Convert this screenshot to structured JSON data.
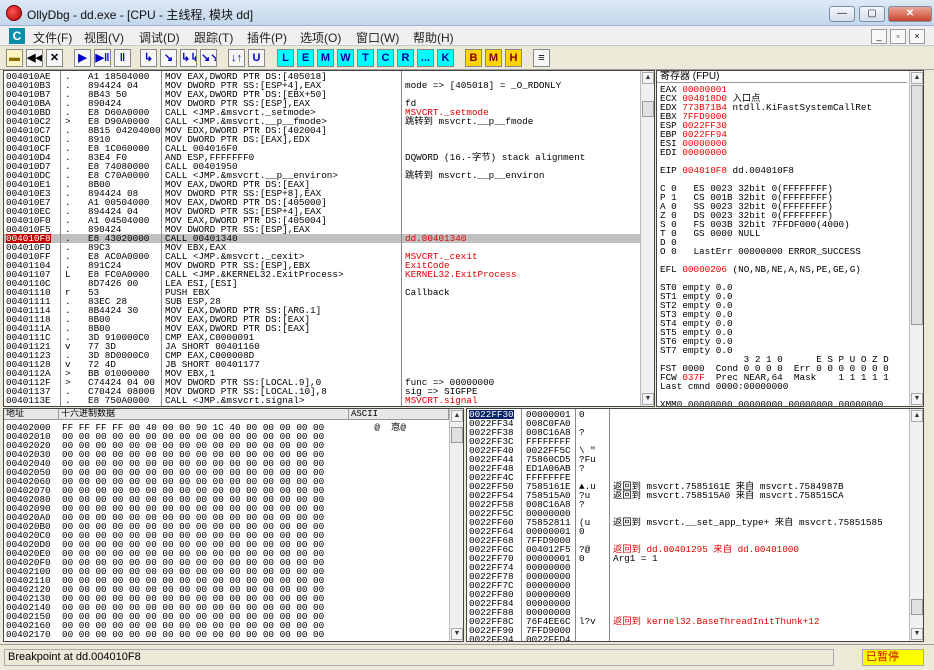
{
  "window": {
    "title": "OllyDbg - dd.exe - [CPU - 主线程, 模块 dd]",
    "min": "—",
    "max": "▢",
    "close": "✕"
  },
  "menu": {
    "cpu_icon": "C",
    "items": [
      "文件(F)",
      "视图(V)",
      "调试(D)",
      "跟踪(T)",
      "插件(P)",
      "选项(O)",
      "窗口(W)",
      "帮助(H)"
    ],
    "mdi": [
      "_",
      "▫",
      "×"
    ]
  },
  "toolbar": {
    "nav": [
      "▶▶",
      "◀◀",
      "✕",
      "▶",
      "▶‖",
      "‖",
      "↳",
      "↘",
      "↳↳",
      "↘↘",
      "↓↑",
      "U"
    ],
    "letters": [
      "L",
      "E",
      "M",
      "W",
      "T",
      "C",
      "R",
      "...",
      "K"
    ],
    "extra": [
      "B",
      "M",
      "H",
      "≡"
    ]
  },
  "disasm": {
    "rows": [
      {
        "addr": "004010AE",
        "mark": ".",
        "hex": "A1 18504000",
        "code": "MOV EAX,DWORD PTR DS:[405018]",
        "comment": ""
      },
      {
        "addr": "004010B3",
        "mark": ".",
        "hex": "894424 04",
        "code": "MOV DWORD PTR SS:[ESP+4],EAX",
        "comment": "mode => [405018] = _O_RDONLY"
      },
      {
        "addr": "004010B7",
        "mark": ".",
        "hex": "8B43 50",
        "code": "MOV EAX,DWORD PTR DS:[EBX+50]",
        "comment": ""
      },
      {
        "addr": "004010BA",
        "mark": ".",
        "hex": "890424",
        "code": "MOV DWORD PTR SS:[ESP],EAX",
        "comment": "fd"
      },
      {
        "addr": "004010BD",
        "mark": ".",
        "hex": "E8 D60A0000",
        "code": "CALL <JMP.&msvcrt._setmode>",
        "comment": "MSVCRT._setmode"
      },
      {
        "addr": "004010C2",
        "mark": ">",
        "hex": "E8 D90A0000",
        "code": "CALL <JMP.&msvcrt.__p__fmode>",
        "comment": "跳转到 msvcrt.__p__fmode"
      },
      {
        "addr": "004010C7",
        "mark": ".",
        "hex": "8B15 04204000",
        "code": "MOV EDX,DWORD PTR DS:[402004]",
        "comment": ""
      },
      {
        "addr": "004010CD",
        "mark": ".",
        "hex": "8910",
        "code": "MOV DWORD PTR DS:[EAX],EDX",
        "comment": ""
      },
      {
        "addr": "004010CF",
        "mark": ".",
        "hex": "E8 1C060000",
        "code": "CALL 004016F0",
        "comment": ""
      },
      {
        "addr": "004010D4",
        "mark": ".",
        "hex": "83E4 F0",
        "code": "AND ESP,FFFFFFF0",
        "comment": "DQWORD (16.-字节) stack alignment"
      },
      {
        "addr": "004010D7",
        "mark": ".",
        "hex": "E8 74080000",
        "code": "CALL 00401950",
        "comment": ""
      },
      {
        "addr": "004010DC",
        "mark": ".",
        "hex": "E8 C70A0000",
        "code": "CALL <JMP.&msvcrt.__p__environ>",
        "comment": "跳转到 msvcrt.__p__environ"
      },
      {
        "addr": "004010E1",
        "mark": ".",
        "hex": "8B00",
        "code": "MOV EAX,DWORD PTR DS:[EAX]",
        "comment": ""
      },
      {
        "addr": "004010E3",
        "mark": ".",
        "hex": "894424 08",
        "code": "MOV DWORD PTR SS:[ESP+8],EAX",
        "comment": ""
      },
      {
        "addr": "004010E7",
        "mark": ".",
        "hex": "A1 00504000",
        "code": "MOV EAX,DWORD PTR DS:[405000]",
        "comment": ""
      },
      {
        "addr": "004010EC",
        "mark": ".",
        "hex": "894424 04",
        "code": "MOV DWORD PTR SS:[ESP+4],EAX",
        "comment": ""
      },
      {
        "addr": "004010F0",
        "mark": ".",
        "hex": "A1 04504000",
        "code": "MOV EAX,DWORD PTR DS:[405004]",
        "comment": ""
      },
      {
        "addr": "004010F5",
        "mark": ".",
        "hex": "890424",
        "code": "MOV DWORD PTR SS:[ESP],EAX",
        "comment": ""
      },
      {
        "addr": "004010F8",
        "mark": ".",
        "hex": "E8 43020000",
        "code": "CALL 00401340",
        "comment": "dd.00401340",
        "selected": true
      },
      {
        "addr": "004010FD",
        "mark": ".",
        "hex": "89C3",
        "code": "MOV EBX,EAX",
        "comment": ""
      },
      {
        "addr": "004010FF",
        "mark": ".",
        "hex": "E8 AC0A0000",
        "code": "CALL <JMP.&msvcrt._cexit>",
        "comment": "MSVCRT._cexit"
      },
      {
        "addr": "00401104",
        "mark": ".",
        "hex": "891C24",
        "code": "MOV DWORD PTR SS:[ESP],EBX",
        "comment": "ExitCode"
      },
      {
        "addr": "00401107",
        "mark": "L",
        "hex": "E8 FC0A0000",
        "code": "CALL <JMP.&KERNEL32.ExitProcess>",
        "comment": "KERNEL32.ExitProcess"
      },
      {
        "addr": "0040110C",
        "mark": "",
        "hex": "8D7426 00",
        "code": "LEA ESI,[ESI]",
        "comment": ""
      },
      {
        "addr": "00401110",
        "mark": "r",
        "hex": "53",
        "code": "PUSH EBX",
        "comment": "Callback"
      },
      {
        "addr": "00401111",
        "mark": ".",
        "hex": "83EC 28",
        "code": "SUB ESP,28",
        "comment": ""
      },
      {
        "addr": "00401114",
        "mark": ".",
        "hex": "8B4424 30",
        "code": "MOV EAX,DWORD PTR SS:[ARG.1]",
        "comment": ""
      },
      {
        "addr": "00401118",
        "mark": ".",
        "hex": "8B00",
        "code": "MOV EAX,DWORD PTR DS:[EAX]",
        "comment": ""
      },
      {
        "addr": "0040111A",
        "mark": ".",
        "hex": "8B00",
        "code": "MOV EAX,DWORD PTR DS:[EAX]",
        "comment": ""
      },
      {
        "addr": "0040111C",
        "mark": ".",
        "hex": "3D 910000C0",
        "code": "CMP EAX,C0000091",
        "comment": ""
      },
      {
        "addr": "00401121",
        "mark": "v",
        "hex": "77 3D",
        "code": "JA SHORT 00401160",
        "comment": ""
      },
      {
        "addr": "00401123",
        "mark": ".",
        "hex": "3D 8D0000C0",
        "code": "CMP EAX,C000008D",
        "comment": ""
      },
      {
        "addr": "00401128",
        "mark": "v",
        "hex": "72 4D",
        "code": "JB SHORT 00401177",
        "comment": ""
      },
      {
        "addr": "0040112A",
        "mark": ">",
        "hex": "BB 01000000",
        "code": "MOV EBX,1",
        "comment": ""
      },
      {
        "addr": "0040112F",
        "mark": ">",
        "hex": "C74424 04 00",
        "code": "MOV DWORD PTR SS:[LOCAL.9],0",
        "comment": "func => 00000000"
      },
      {
        "addr": "00401137",
        "mark": ".",
        "hex": "C70424 08000",
        "code": "MOV DWORD PTR SS:[LOCAL.10],8",
        "comment": "sig => SIGFPE"
      },
      {
        "addr": "0040113E",
        "mark": ".",
        "hex": "E8 750A0000",
        "code": "CALL <JMP.&msvcrt.signal>",
        "comment": "MSVCRT.signal"
      }
    ]
  },
  "registers": {
    "header": "寄存器 (FPU)",
    "lines": [
      {
        "t": "EAX ",
        "v": "00000001",
        "r": ""
      },
      {
        "t": "ECX ",
        "v": "004018D0",
        "r": " 入口点"
      },
      {
        "t": "EDX ",
        "v": "773B71B4",
        "r": " ntdll.KiFastSystemCallRet"
      },
      {
        "t": "EBX ",
        "v": "7FFD9000",
        "r": ""
      },
      {
        "t": "ESP ",
        "v": "0022FF30",
        "r": ""
      },
      {
        "t": "EBP ",
        "v": "0022FF94",
        "r": ""
      },
      {
        "t": "ESI ",
        "v": "00000000",
        "r": ""
      },
      {
        "t": "EDI ",
        "v": "00000000",
        "r": ""
      },
      {
        "t": "",
        "v": "",
        "r": ""
      },
      {
        "t": "EIP ",
        "v": "004010F8",
        "r": " dd.004010F8"
      },
      {
        "t": "",
        "v": "",
        "r": ""
      },
      {
        "t": "C 0   ES 0023 32bit 0(FFFFFFFF)",
        "v": "",
        "r": ""
      },
      {
        "t": "P 1   CS 001B 32bit 0(FFFFFFFF)",
        "v": "",
        "r": ""
      },
      {
        "t": "A 0   SS 0023 32bit 0(FFFFFFFF)",
        "v": "",
        "r": ""
      },
      {
        "t": "Z 0   DS 0023 32bit 0(FFFFFFFF)",
        "v": "",
        "r": ""
      },
      {
        "t": "S 0   FS 003B 32bit 7FFDF000(4000)",
        "v": "",
        "r": ""
      },
      {
        "t": "T 0   GS 0000 NULL",
        "v": "",
        "r": ""
      },
      {
        "t": "D 0",
        "v": "",
        "r": ""
      },
      {
        "t": "O 0   LastErr 00000000 ERROR_SUCCESS",
        "v": "",
        "r": ""
      },
      {
        "t": "",
        "v": "",
        "r": ""
      },
      {
        "t": "EFL ",
        "v": "00000206",
        "r": " (NO,NB,NE,A,NS,PE,GE,G)"
      },
      {
        "t": "",
        "v": "",
        "r": ""
      },
      {
        "t": "ST0 empty 0.0",
        "v": "",
        "r": ""
      },
      {
        "t": "ST1 empty 0.0",
        "v": "",
        "r": ""
      },
      {
        "t": "ST2 empty 0.0",
        "v": "",
        "r": ""
      },
      {
        "t": "ST3 empty 0.0",
        "v": "",
        "r": ""
      },
      {
        "t": "ST4 empty 0.0",
        "v": "",
        "r": ""
      },
      {
        "t": "ST5 empty 0.0",
        "v": "",
        "r": ""
      },
      {
        "t": "ST6 empty 0.0",
        "v": "",
        "r": ""
      },
      {
        "t": "ST7 empty 0.0",
        "v": "",
        "r": ""
      },
      {
        "t": "               3 2 1 0      E S P U O Z D",
        "v": "",
        "r": ""
      },
      {
        "t": "FST 0000  Cond 0 0 0 0  Err 0 0 0 0 0 0 0",
        "v": "",
        "r": ""
      },
      {
        "t": "FCW ",
        "v": "037F",
        "r": "  Prec NEAR,64  Mask    1 1 1 1 1"
      },
      {
        "t": "Last cmnd 0000:00000000",
        "v": "",
        "r": ""
      },
      {
        "t": "",
        "v": "",
        "r": ""
      },
      {
        "t": "XMM0 00000000 00000000 00000000 00000000",
        "v": "",
        "r": ""
      },
      {
        "t": "XMM1 00000000 00000000 00000000 00000000",
        "v": "",
        "r": ""
      },
      {
        "t": "XMM2 00000000 00000000 00000000 00000000",
        "v": "",
        "r": ""
      }
    ]
  },
  "dump": {
    "headers": [
      "地址",
      "十六进制数据",
      "ASCII"
    ],
    "rows": [
      {
        "addr": "00402000",
        "hex": "FF FF FF FF 00 40 00 00 90 1C 40 00 00 00 00 00",
        "ascii": "    @  恴@"
      },
      {
        "addr": "00402010",
        "hex": "00 00 00 00 00 00 00 00 00 00 00 00 00 00 00 00",
        "ascii": ""
      },
      {
        "addr": "00402020",
        "hex": "00 00 00 00 00 00 00 00 00 00 00 00 00 00 00 00",
        "ascii": ""
      },
      {
        "addr": "00402030",
        "hex": "00 00 00 00 00 00 00 00 00 00 00 00 00 00 00 00",
        "ascii": ""
      },
      {
        "addr": "00402040",
        "hex": "00 00 00 00 00 00 00 00 00 00 00 00 00 00 00 00",
        "ascii": ""
      },
      {
        "addr": "00402050",
        "hex": "00 00 00 00 00 00 00 00 00 00 00 00 00 00 00 00",
        "ascii": ""
      },
      {
        "addr": "00402060",
        "hex": "00 00 00 00 00 00 00 00 00 00 00 00 00 00 00 00",
        "ascii": ""
      },
      {
        "addr": "00402070",
        "hex": "00 00 00 00 00 00 00 00 00 00 00 00 00 00 00 00",
        "ascii": ""
      },
      {
        "addr": "00402080",
        "hex": "00 00 00 00 00 00 00 00 00 00 00 00 00 00 00 00",
        "ascii": ""
      },
      {
        "addr": "00402090",
        "hex": "00 00 00 00 00 00 00 00 00 00 00 00 00 00 00 00",
        "ascii": ""
      },
      {
        "addr": "004020A0",
        "hex": "00 00 00 00 00 00 00 00 00 00 00 00 00 00 00 00",
        "ascii": ""
      },
      {
        "addr": "004020B0",
        "hex": "00 00 00 00 00 00 00 00 00 00 00 00 00 00 00 00",
        "ascii": ""
      },
      {
        "addr": "004020C0",
        "hex": "00 00 00 00 00 00 00 00 00 00 00 00 00 00 00 00",
        "ascii": ""
      },
      {
        "addr": "004020D0",
        "hex": "00 00 00 00 00 00 00 00 00 00 00 00 00 00 00 00",
        "ascii": ""
      },
      {
        "addr": "004020E0",
        "hex": "00 00 00 00 00 00 00 00 00 00 00 00 00 00 00 00",
        "ascii": ""
      },
      {
        "addr": "004020F0",
        "hex": "00 00 00 00 00 00 00 00 00 00 00 00 00 00 00 00",
        "ascii": ""
      },
      {
        "addr": "00402100",
        "hex": "00 00 00 00 00 00 00 00 00 00 00 00 00 00 00 00",
        "ascii": ""
      },
      {
        "addr": "00402110",
        "hex": "00 00 00 00 00 00 00 00 00 00 00 00 00 00 00 00",
        "ascii": ""
      },
      {
        "addr": "00402120",
        "hex": "00 00 00 00 00 00 00 00 00 00 00 00 00 00 00 00",
        "ascii": ""
      },
      {
        "addr": "00402130",
        "hex": "00 00 00 00 00 00 00 00 00 00 00 00 00 00 00 00",
        "ascii": ""
      },
      {
        "addr": "00402140",
        "hex": "00 00 00 00 00 00 00 00 00 00 00 00 00 00 00 00",
        "ascii": ""
      },
      {
        "addr": "00402150",
        "hex": "00 00 00 00 00 00 00 00 00 00 00 00 00 00 00 00",
        "ascii": ""
      },
      {
        "addr": "00402160",
        "hex": "00 00 00 00 00 00 00 00 00 00 00 00 00 00 00 00",
        "ascii": ""
      },
      {
        "addr": "00402170",
        "hex": "00 00 00 00 00 00 00 00 00 00 00 00 00 00 00 00",
        "ascii": ""
      }
    ]
  },
  "stack": {
    "rows": [
      {
        "addr": "0022FF30",
        "val": "00000001",
        "asc": "0",
        "cmt": "",
        "sel": true
      },
      {
        "addr": "0022FF34",
        "val": "008C0FA0",
        "asc": "",
        "cmt": ""
      },
      {
        "addr": "0022FF38",
        "val": "008C16A8",
        "asc": "?",
        "cmt": ""
      },
      {
        "addr": "0022FF3C",
        "val": "FFFFFFFF",
        "asc": "",
        "cmt": ""
      },
      {
        "addr": "0022FF40",
        "val": "0022FF5C",
        "asc": "\\ \"",
        "cmt": ""
      },
      {
        "addr": "0022FF44",
        "val": "75860CD5",
        "asc": "?Fu",
        "cmt": ""
      },
      {
        "addr": "0022FF48",
        "val": "ED1A06AB",
        "asc": "?",
        "cmt": ""
      },
      {
        "addr": "0022FF4C",
        "val": "FFFFFFFE",
        "asc": "",
        "cmt": ""
      },
      {
        "addr": "0022FF50",
        "val": "7585161E",
        "asc": "▲.u",
        "cmt": "返回到 msvcrt.7585161E 来自 msvcrt.7584987B"
      },
      {
        "addr": "0022FF54",
        "val": "758515A0",
        "asc": "?u",
        "cmt": "返回到 msvcrt.758515A0 来自 msvcrt.758515CA"
      },
      {
        "addr": "0022FF58",
        "val": "008C16A8",
        "asc": "?",
        "cmt": ""
      },
      {
        "addr": "0022FF5C",
        "val": "00000000",
        "asc": "",
        "cmt": ""
      },
      {
        "addr": "0022FF60",
        "val": "75852811",
        "asc": "(u",
        "cmt": "返回到 msvcrt.__set_app_type+ 来自 msvcrt.75851585"
      },
      {
        "addr": "0022FF64",
        "val": "00000001",
        "asc": "0",
        "cmt": ""
      },
      {
        "addr": "0022FF68",
        "val": "7FFD9000",
        "asc": "",
        "cmt": ""
      },
      {
        "addr": "0022FF6C",
        "val": "004012F5",
        "asc": "?@",
        "cmt": "返回到 dd.00401295 来自 dd.00401000"
      },
      {
        "addr": "0022FF70",
        "val": "00000001",
        "asc": "0",
        "cmt": "Arg1 = 1"
      },
      {
        "addr": "0022FF74",
        "val": "00000000",
        "asc": "",
        "cmt": ""
      },
      {
        "addr": "0022FF78",
        "val": "00000000",
        "asc": "",
        "cmt": ""
      },
      {
        "addr": "0022FF7C",
        "val": "00000000",
        "asc": "",
        "cmt": ""
      },
      {
        "addr": "0022FF80",
        "val": "00000000",
        "asc": "",
        "cmt": ""
      },
      {
        "addr": "0022FF84",
        "val": "00000000",
        "asc": "",
        "cmt": ""
      },
      {
        "addr": "0022FF88",
        "val": "00000000",
        "asc": "",
        "cmt": ""
      },
      {
        "addr": "0022FF8C",
        "val": "76F4EE6C",
        "asc": "l?v",
        "cmt": "返回到 kernel32.BaseThreadInitThunk+12"
      },
      {
        "addr": "0022FF90",
        "val": "7FFD9000",
        "asc": "",
        "cmt": ""
      },
      {
        "addr": "0022FF94",
        "val": "0022FFD4",
        "asc": "",
        "cmt": ""
      }
    ]
  },
  "status": {
    "text": "Breakpoint at dd.004010F8",
    "state": "已暂停"
  },
  "colors": {
    "accent": "#0a8ea8",
    "red": "#e00000",
    "selected": "#c0c0c0",
    "paused": "#ffff00"
  }
}
